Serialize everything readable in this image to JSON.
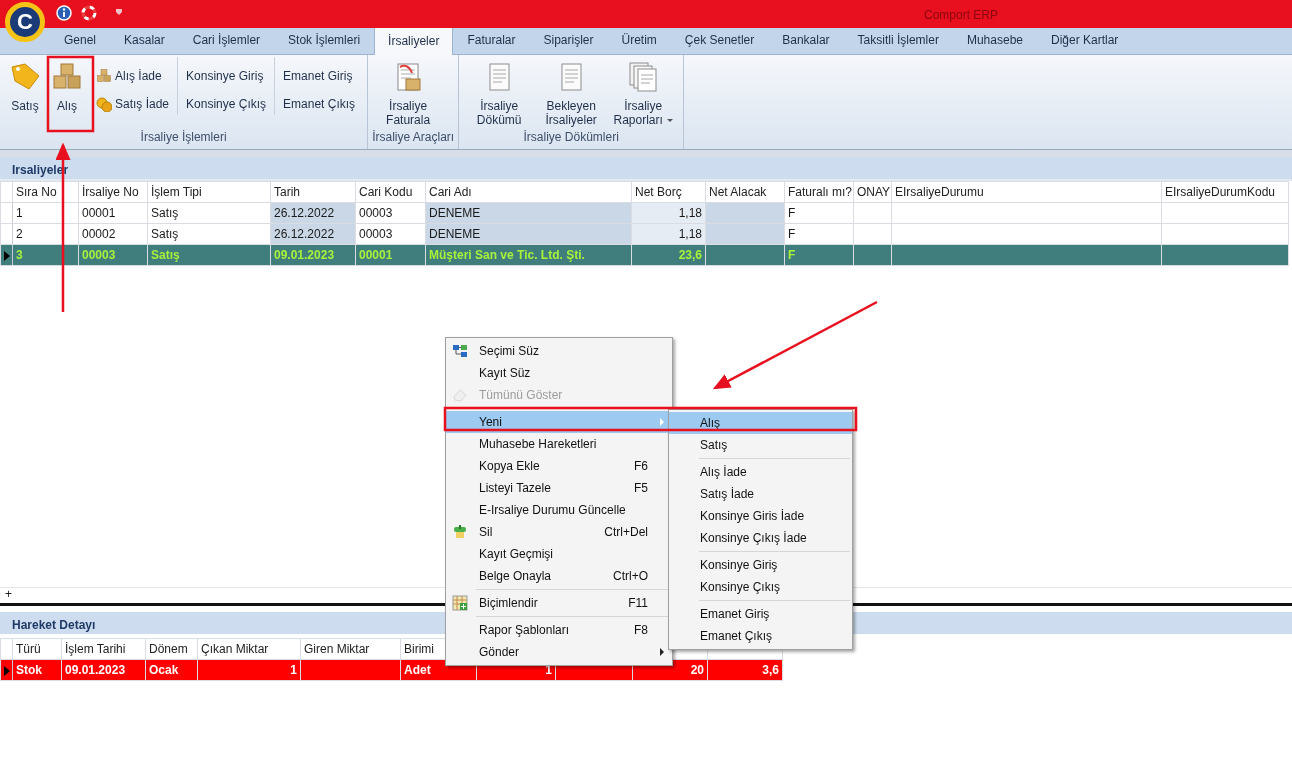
{
  "title_bar": {
    "logo": "C",
    "title": "Comport ERP"
  },
  "tabs": [
    {
      "label": "Genel",
      "selected": false
    },
    {
      "label": "Kasalar",
      "selected": false
    },
    {
      "label": "Cari İşlemler",
      "selected": false
    },
    {
      "label": "Stok İşlemleri",
      "selected": false
    },
    {
      "label": "İrsaliyeler",
      "selected": true
    },
    {
      "label": "Faturalar",
      "selected": false
    },
    {
      "label": "Siparişler",
      "selected": false
    },
    {
      "label": "Üretim",
      "selected": false
    },
    {
      "label": "Çek Senetler",
      "selected": false
    },
    {
      "label": "Bankalar",
      "selected": false
    },
    {
      "label": "Taksitli İşlemler",
      "selected": false
    },
    {
      "label": "Muhasebe",
      "selected": false
    },
    {
      "label": "Diğer Kartlar",
      "selected": false
    }
  ],
  "ribbon": {
    "groups": [
      {
        "label": "İrsaliye İşlemleri",
        "buttons": [
          {
            "kind": "large",
            "label": "Satış"
          },
          {
            "kind": "large",
            "label": "Alış"
          },
          {
            "kind": "stack",
            "items": [
              {
                "label": "Alış İade"
              },
              {
                "label": "Satış İade"
              }
            ]
          },
          {
            "kind": "stack",
            "items": [
              {
                "label": "Konsinye Giriş"
              },
              {
                "label": "Konsinye Çıkış"
              }
            ]
          },
          {
            "kind": "stack",
            "items": [
              {
                "label": "Emanet Giriş"
              },
              {
                "label": "Emanet Çıkış"
              }
            ]
          }
        ]
      },
      {
        "label": "İrsaliye Araçları",
        "buttons": [
          {
            "kind": "large",
            "label": "İrsaliye Faturala"
          }
        ]
      },
      {
        "label": "İrsaliye Dökümleri",
        "buttons": [
          {
            "kind": "large",
            "label": "İrsaliye Dökümü"
          },
          {
            "kind": "large",
            "label": "Bekleyen İrsaliyeler"
          },
          {
            "kind": "large",
            "label": "İrsaliye Raporları",
            "dropdown": true
          }
        ]
      }
    ]
  },
  "waybills": {
    "title": "Irsaliyeler",
    "columns": [
      "Sıra No",
      "İrsaliye No",
      "İşlem Tipi",
      "Tarih",
      "Cari Kodu",
      "Cari Adı",
      "Net Borç",
      "Net Alacak",
      "Faturalı mı?",
      "ONAY",
      "EIrsaliyeDurumu",
      "EIrsaliyeDurumKodu"
    ],
    "rows": [
      {
        "selected": false,
        "cells": [
          "1",
          "00001",
          "Satış",
          "26.12.2022",
          "00003",
          "DENEME",
          "1,18",
          null,
          "F",
          null,
          null,
          null
        ]
      },
      {
        "selected": false,
        "cells": [
          "2",
          "00002",
          "Satış",
          "26.12.2022",
          "00003",
          "DENEME",
          "1,18",
          null,
          "F",
          null,
          null,
          null
        ]
      },
      {
        "selected": true,
        "cells": [
          "3",
          "00003",
          "Satış",
          "09.01.2023",
          "00001",
          "Müşteri San ve Tic. Ltd. Şti.",
          "23,6",
          null,
          "F",
          null,
          null,
          null
        ]
      }
    ],
    "footer": "+"
  },
  "movements": {
    "title": "Hareket Detayı",
    "columns": [
      "Türü",
      "İşlem Tarihi",
      "Dönem",
      "Çıkan Miktar",
      "Giren Miktar",
      "Birimi"
    ],
    "rows": [
      {
        "selected": true,
        "cells": [
          "Stok",
          "09.01.2023",
          "Ocak",
          "1",
          null,
          "Adet",
          "1",
          null,
          "20",
          "3,6"
        ]
      }
    ]
  },
  "context_menu": {
    "items": [
      {
        "kind": "item",
        "label": "Seçimi Süz",
        "disabled": false,
        "selected": false
      },
      {
        "kind": "item",
        "label": "Kayıt Süz",
        "disabled": false,
        "selected": false
      },
      {
        "kind": "item",
        "label": "Tümünü Göster",
        "disabled": true,
        "selected": false
      },
      {
        "kind": "separator"
      },
      {
        "kind": "submenu",
        "label": "Yeni",
        "disabled": false,
        "selected": true
      },
      {
        "kind": "item",
        "label": "Muhasebe Hareketleri",
        "disabled": false,
        "selected": false
      },
      {
        "kind": "item",
        "label": "Kopya Ekle",
        "shortcut": "F6",
        "disabled": false,
        "selected": false
      },
      {
        "kind": "item",
        "label": "Listeyi Tazele",
        "shortcut": "F5",
        "disabled": false,
        "selected": false
      },
      {
        "kind": "item",
        "label": "E-Irsaliye Durumu Güncelle",
        "disabled": false,
        "selected": false
      },
      {
        "kind": "item",
        "label": "Sil",
        "shortcut": "Ctrl+Del",
        "disabled": false,
        "selected": false
      },
      {
        "kind": "item",
        "label": "Kayıt Geçmişi",
        "disabled": false,
        "selected": false
      },
      {
        "kind": "item",
        "label": "Belge Onayla",
        "shortcut": "Ctrl+O",
        "disabled": false,
        "selected": false
      },
      {
        "kind": "separator"
      },
      {
        "kind": "item",
        "label": "Biçimlendir",
        "shortcut": "F11",
        "disabled": false,
        "selected": false
      },
      {
        "kind": "separator"
      },
      {
        "kind": "item",
        "label": "Rapor Şablonları",
        "shortcut": "F8",
        "disabled": false,
        "selected": false
      },
      {
        "kind": "submenu",
        "label": "Gönder",
        "disabled": false,
        "selected": false
      }
    ]
  },
  "submenu": {
    "items": [
      {
        "kind": "item",
        "label": "Alış",
        "selected": true
      },
      {
        "kind": "item",
        "label": "Satış",
        "selected": false
      },
      {
        "kind": "separator"
      },
      {
        "kind": "item",
        "label": "Alış İade",
        "selected": false
      },
      {
        "kind": "item",
        "label": "Satış İade",
        "selected": false
      },
      {
        "kind": "item",
        "label": "Konsinye Giris İade",
        "selected": false
      },
      {
        "kind": "item",
        "label": "Konsinye Çıkış İade",
        "selected": false
      },
      {
        "kind": "separator"
      },
      {
        "kind": "item",
        "label": "Konsinye Giriş",
        "selected": false
      },
      {
        "kind": "item",
        "label": "Konsinye Çıkış",
        "selected": false
      },
      {
        "kind": "separator"
      },
      {
        "kind": "item",
        "label": "Emanet Giriş",
        "selected": false
      },
      {
        "kind": "item",
        "label": "Emanet Çıkış",
        "selected": false
      }
    ]
  }
}
